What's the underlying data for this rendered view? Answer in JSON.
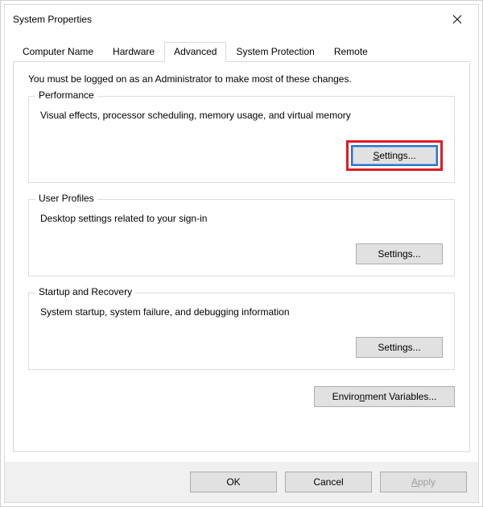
{
  "window": {
    "title": "System Properties"
  },
  "tabs": {
    "computer_name": "Computer Name",
    "hardware": "Hardware",
    "advanced": "Advanced",
    "system_protection": "System Protection",
    "remote": "Remote"
  },
  "intro": "You must be logged on as an Administrator to make most of these changes.",
  "performance": {
    "legend": "Performance",
    "desc": "Visual effects, processor scheduling, memory usage, and virtual memory",
    "button_prefix": "S",
    "button_rest": "ettings..."
  },
  "user_profiles": {
    "legend": "User Profiles",
    "desc": "Desktop settings related to your sign-in",
    "button": "Settings..."
  },
  "startup": {
    "legend": "Startup and Recovery",
    "desc": "System startup, system failure, and debugging information",
    "button": "Settings..."
  },
  "env": {
    "prefix": "Enviro",
    "accel": "n",
    "suffix": "ment Variables..."
  },
  "buttons": {
    "ok": "OK",
    "cancel": "Cancel",
    "apply_accel": "A",
    "apply_rest": "pply"
  }
}
